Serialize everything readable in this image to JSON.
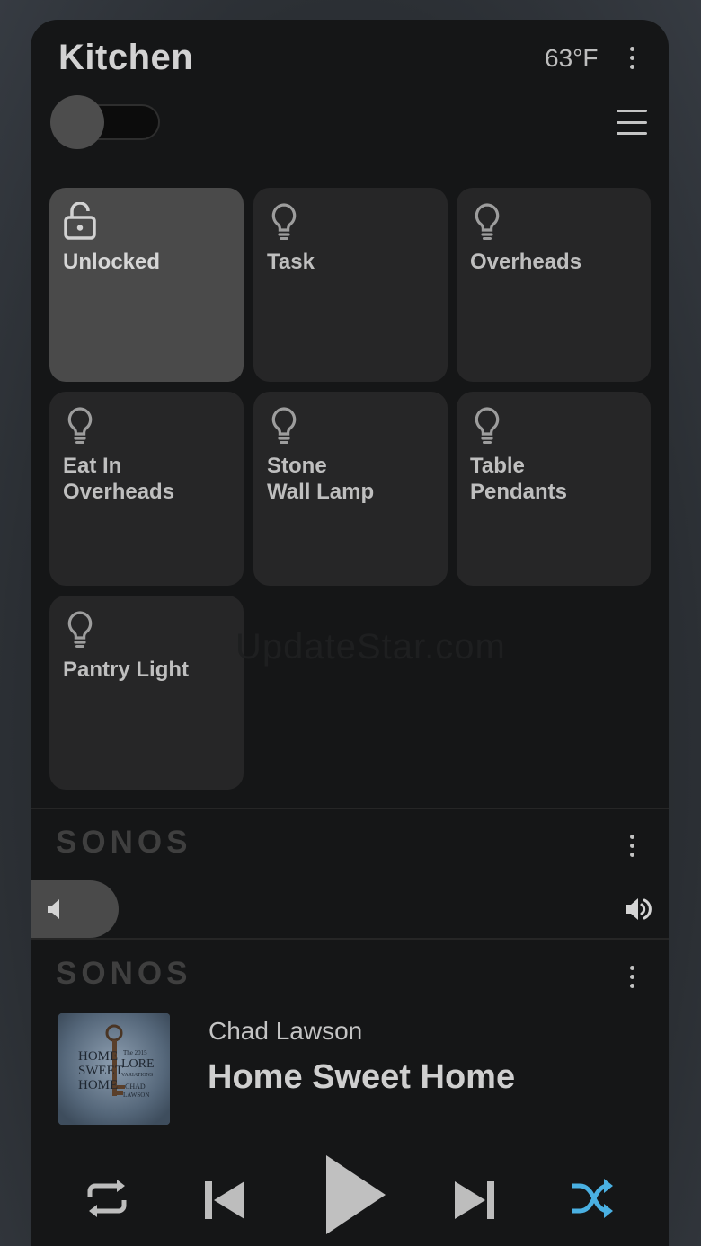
{
  "header": {
    "title": "Kitchen",
    "temperature": "63°F"
  },
  "tiles": [
    {
      "label": "Unlocked",
      "icon": "lock-open-icon",
      "active": true
    },
    {
      "label": "Task",
      "icon": "lightbulb-icon",
      "active": false
    },
    {
      "label": "Overheads",
      "icon": "lightbulb-icon",
      "active": false
    },
    {
      "label": "Eat In\nOverheads",
      "icon": "lightbulb-icon",
      "active": false
    },
    {
      "label": "Stone\nWall Lamp",
      "icon": "lightbulb-icon",
      "active": false
    },
    {
      "label": "Table\nPendants",
      "icon": "lightbulb-icon",
      "active": false
    },
    {
      "label": "Pantry Light",
      "icon": "lightbulb-icon",
      "active": false
    }
  ],
  "volume_card": {
    "brand": "SONOS",
    "volume_fraction": 0.14
  },
  "player_card": {
    "brand": "SONOS",
    "artist": "Chad Lawson",
    "track": "Home Sweet Home",
    "album_art_text": [
      "HOME",
      "SWEET",
      "HOME",
      "The 2015",
      "LORE",
      "VARIATIONS",
      "CHAD",
      "LAWSON"
    ]
  },
  "controls": [
    "repeat-icon",
    "previous-icon",
    "play-icon",
    "next-icon",
    "shuffle-icon"
  ],
  "colors": {
    "shuffle_active": "#4ab0e2",
    "tile_active": "#4a4a4a",
    "tile_inactive": "#262627"
  },
  "watermark": "UpdateStar.com"
}
